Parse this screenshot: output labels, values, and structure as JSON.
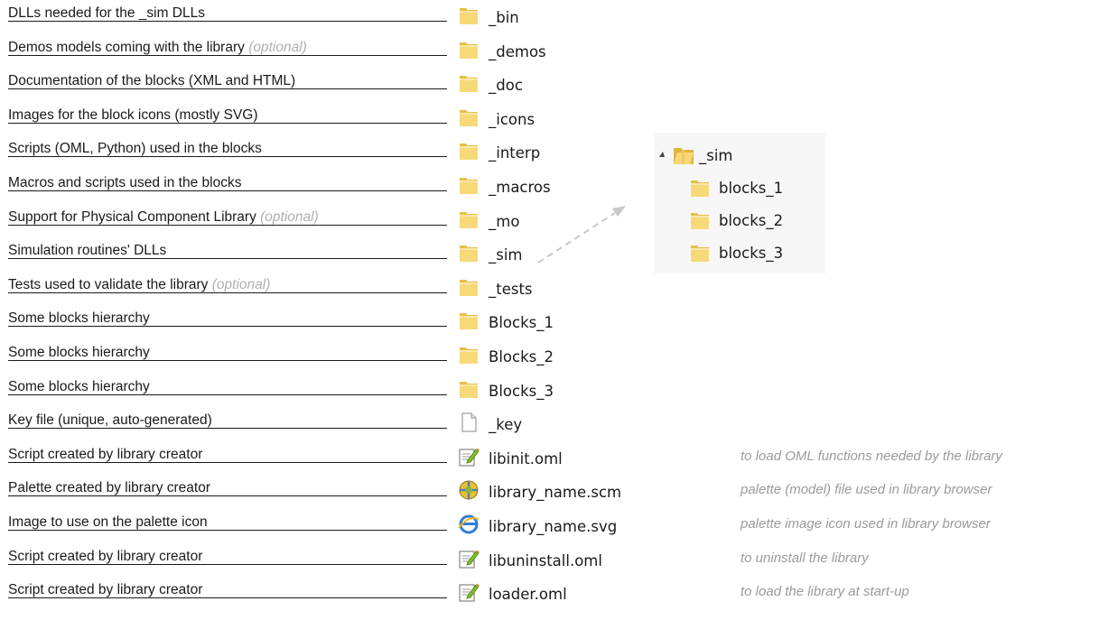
{
  "rows": [
    {
      "text": "DLLs needed for the _sim DLLs",
      "optional": "",
      "icon": "folder-icon",
      "name": "_bin",
      "note": ""
    },
    {
      "text": "Demos models coming with the library ",
      "optional": "(optional)",
      "icon": "folder-icon",
      "name": "_demos",
      "note": ""
    },
    {
      "text": "Documentation of the blocks (XML and HTML)",
      "optional": "",
      "icon": "folder-icon",
      "name": "_doc",
      "note": ""
    },
    {
      "text": "Images for the block icons (mostly SVG)",
      "optional": "",
      "icon": "folder-icon",
      "name": "_icons",
      "note": ""
    },
    {
      "text": "Scripts (OML, Python) used in the blocks",
      "optional": "",
      "icon": "folder-icon",
      "name": "_interp",
      "note": ""
    },
    {
      "text": "Macros and scripts used in the blocks",
      "optional": "",
      "icon": "folder-icon",
      "name": "_macros",
      "note": ""
    },
    {
      "text": "Support for Physical Component Library ",
      "optional": "(optional)",
      "icon": "folder-icon",
      "name": "_mo",
      "note": ""
    },
    {
      "text": "Simulation routines' DLLs",
      "optional": "",
      "icon": "folder-icon",
      "name": "_sim",
      "note": ""
    },
    {
      "text": "Tests used to validate the library ",
      "optional": "(optional)",
      "icon": "folder-icon",
      "name": "_tests",
      "note": ""
    },
    {
      "text": "Some blocks hierarchy",
      "optional": "",
      "icon": "folder-icon",
      "name": "Blocks_1",
      "note": ""
    },
    {
      "text": "Some blocks hierarchy",
      "optional": "",
      "icon": "folder-icon",
      "name": "Blocks_2",
      "note": ""
    },
    {
      "text": "Some blocks hierarchy",
      "optional": "",
      "icon": "folder-icon",
      "name": "Blocks_3",
      "note": ""
    },
    {
      "text": "Key file (unique, auto-generated)",
      "optional": "",
      "icon": "file-icon",
      "name": "_key",
      "note": ""
    },
    {
      "text": "Script created by library creator",
      "optional": "",
      "icon": "script-icon",
      "name": "libinit.oml",
      "note": "to load OML functions needed by the library"
    },
    {
      "text": "Palette created by library creator",
      "optional": "",
      "icon": "palette-icon",
      "name": "library_name.scm",
      "note": "palette (model) file used in library browser"
    },
    {
      "text": "Image to use on the palette icon",
      "optional": "",
      "icon": "browser-icon",
      "name": "library_name.svg",
      "note": "palette image icon used in library browser"
    },
    {
      "text": "Script created by library creator ",
      "optional": "",
      "icon": "script-icon",
      "name": "libuninstall.oml",
      "note": "to uninstall the library"
    },
    {
      "text": "Script created by library creator ",
      "optional": "",
      "icon": "script-icon",
      "name": "loader.oml",
      "note": "to load the library at start-up"
    }
  ],
  "tree": {
    "root": "_sim",
    "children": [
      "blocks_1",
      "blocks_2",
      "blocks_3"
    ]
  },
  "colors": {
    "folder": "#f5d16b",
    "folder_dark": "#e2b443",
    "optional_text": "#b0b0b0",
    "note_text": "#9b9b9b",
    "arrow": "#c8c8c8",
    "tree_bg": "#f7f7f7"
  }
}
